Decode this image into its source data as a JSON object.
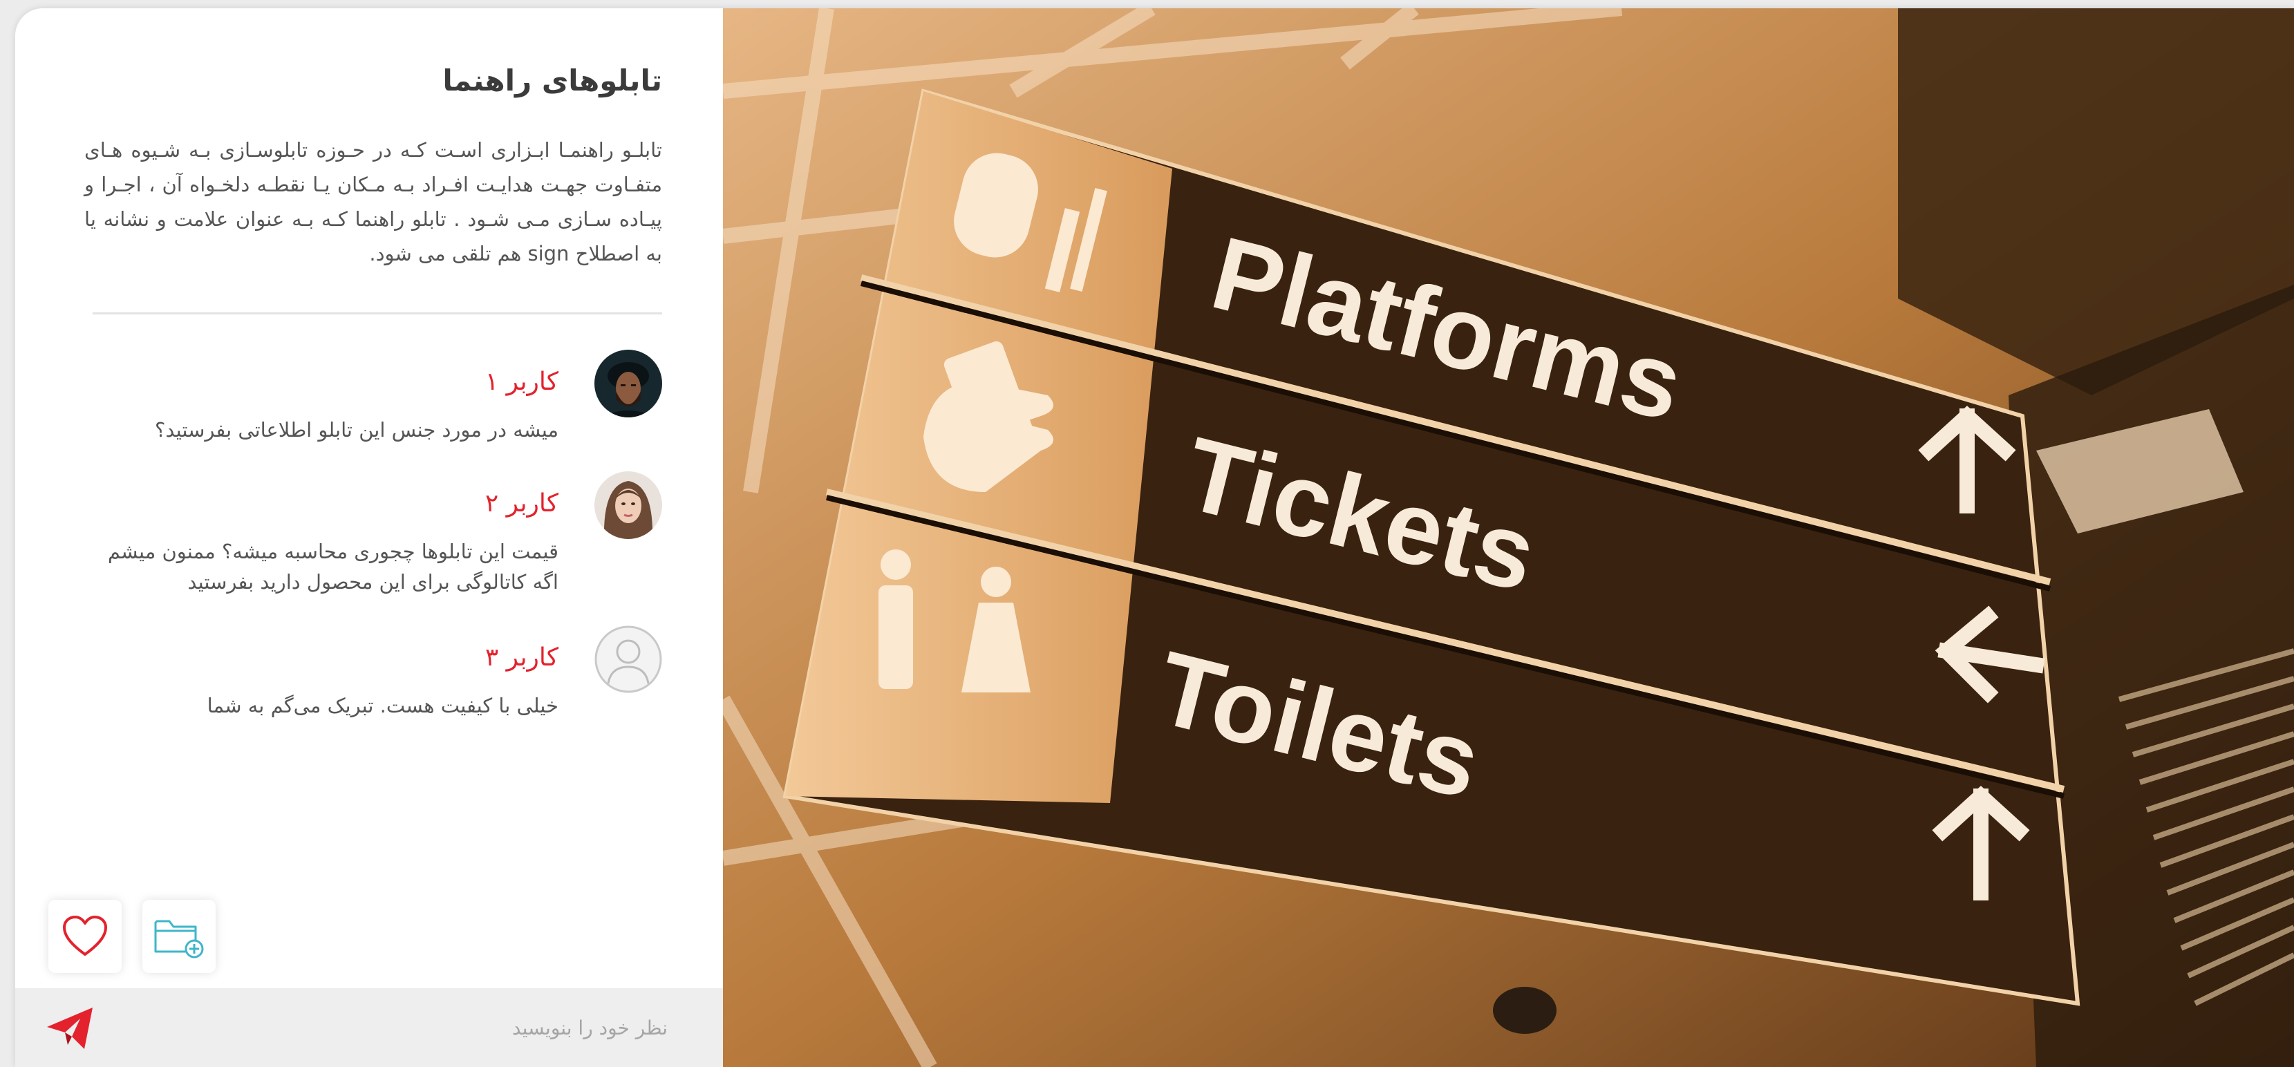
{
  "article": {
    "title": "تابلوهای راهنما",
    "description": "تابلـو راهنمـا ابـزاری اسـت کـه در حـوزه تابلوسـازی بـه شـیوه هـای متفـاوت جهـت هدایـت افـراد بـه مـکان یـا نقطـه دلخـواه آن ، اجـرا و پیـاده سـازی مـی شـود . تابلو راهنما کـه بـه عنوان علامت و نشانه یا به اصطلاح sign هم تلقی می شود."
  },
  "comments": [
    {
      "user": "کاربر ۱",
      "text": "میشه در مورد جنس این تابلو اطلاعاتی بفرستید؟",
      "avatar_icon": "avatar-man-icon"
    },
    {
      "user": "کاربر ۲",
      "text": "قیمت این تابلوها چجوری محاسبه میشه؟ ممنون میشم اگه کاتالوگی برای این محصول دارید بفرستید",
      "avatar_icon": "avatar-woman-icon"
    },
    {
      "user": "کاربر ۳",
      "text": "خیلی با کیفیت هست. تبریک می‌گم به شما",
      "avatar_icon": "avatar-placeholder-icon"
    }
  ],
  "actions": {
    "like_icon": "heart-icon",
    "save_icon": "folder-add-icon"
  },
  "composer": {
    "placeholder": "نظر خود را بنویسید",
    "send_icon": "send-icon"
  },
  "photo": {
    "signs": [
      {
        "label": "Platforms",
        "icon": "train-icon",
        "arrow": "arrow-up-icon"
      },
      {
        "label": "Tickets",
        "icon": "ticket-icon",
        "arrow": "arrow-left-icon"
      },
      {
        "label": "Toilets",
        "icon": "restroom-icon",
        "arrow": "arrow-up-icon"
      }
    ]
  },
  "colors": {
    "accent": "#e3222d",
    "icon_teal": "#3fb6c9",
    "photo_tone": "#c98a45"
  }
}
